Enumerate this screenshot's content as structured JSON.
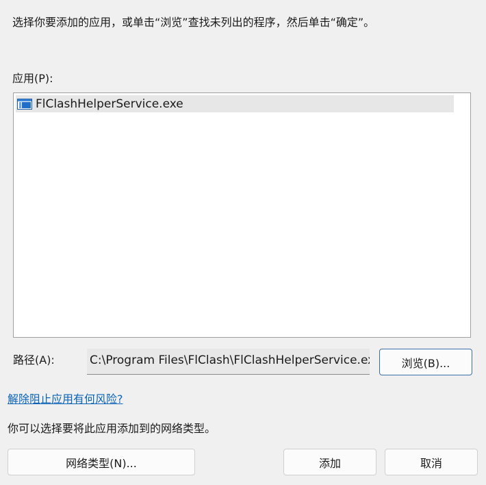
{
  "instruction": "选择你要添加的应用，或单击“浏览”查找未列出的程序，然后单击“确定”。",
  "apps": {
    "label": "应用(P):",
    "items": [
      {
        "name": "FlClashHelperService.exe",
        "icon": "executable-icon"
      }
    ]
  },
  "path": {
    "label": "路径(A):",
    "value": "C:\\Program Files\\FlClash\\FlClashHelperService.exe"
  },
  "buttons": {
    "browse": "浏览(B)...",
    "network_type": "网络类型(N)...",
    "add": "添加",
    "cancel": "取消"
  },
  "risk_link": "解除阻止应用有何风险?",
  "network_text": "你可以选择要将此应用添加到的网络类型。",
  "colors": {
    "background": "#f0f0f0",
    "link": "#0b63b6",
    "focus_border": "#3b6ea8",
    "selected_row": "#e7e7e7"
  }
}
